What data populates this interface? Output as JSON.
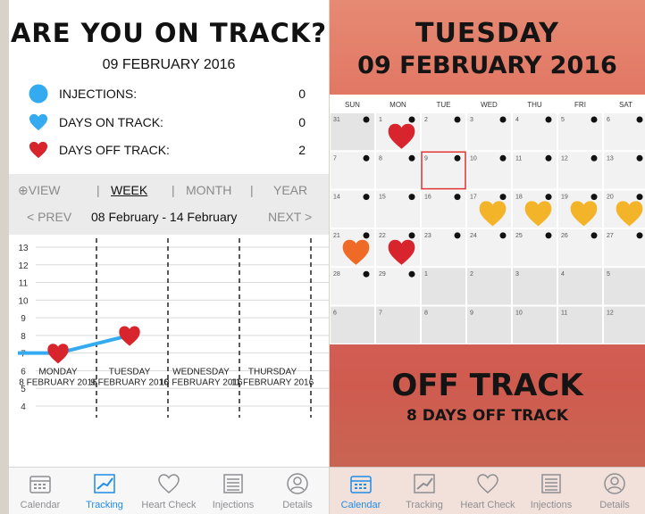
{
  "tracking": {
    "title": "ARE YOU ON TRACK?",
    "date": "09 FEBRUARY 2016",
    "stats": [
      {
        "label": "INJECTIONS:",
        "value": "0",
        "color": "#34aaf0",
        "icon": "circle-icon"
      },
      {
        "label": "DAYS ON TRACK:",
        "value": "0",
        "color": "#34aaf0",
        "icon": "heart-icon"
      },
      {
        "label": "DAYS OFF TRACK:",
        "value": "2",
        "color": "#d8242c",
        "icon": "heart-icon"
      }
    ],
    "view_label": "VIEW",
    "segments": [
      "WEEK",
      "MONTH",
      "YEAR"
    ],
    "active_segment": "WEEK",
    "prev_label": "< PREV",
    "next_label": "NEXT >",
    "range": "08 February - 14 February"
  },
  "chart_data": {
    "type": "line",
    "y_ticks": [
      4,
      5,
      6,
      7,
      8,
      9,
      10,
      11,
      12,
      13
    ],
    "ylim": [
      4,
      13.5
    ],
    "categories": [
      {
        "day": "MONDAY",
        "date": "8 FEBRUARY 2016"
      },
      {
        "day": "TUESDAY",
        "date": "9 FEBRUARY 2016"
      },
      {
        "day": "WEDNESDAY",
        "date": "10 FEBRUARY 2016"
      },
      {
        "day": "THURSDAY",
        "date": "11 FEBRUARY 2016"
      }
    ],
    "series": [
      {
        "values": [
          7,
          8
        ],
        "color": "#34aaf0",
        "marker": "heart",
        "marker_color": "#d8242c"
      }
    ]
  },
  "calendar": {
    "weekday": "TUESDAY",
    "date": "09 FEBRUARY 2016",
    "headers": [
      "SUN",
      "MON",
      "TUE",
      "WED",
      "THU",
      "FRI",
      "SAT"
    ],
    "weeks": [
      [
        "31",
        "1",
        "2",
        "3",
        "4",
        "5",
        "6"
      ],
      [
        "7",
        "8",
        "9",
        "10",
        "11",
        "12",
        "13"
      ],
      [
        "14",
        "15",
        "16",
        "17",
        "18",
        "19",
        "20"
      ],
      [
        "21",
        "22",
        "23",
        "24",
        "25",
        "26",
        "27"
      ],
      [
        "28",
        "29",
        "1",
        "2",
        "3",
        "4",
        "5"
      ],
      [
        "6",
        "7",
        "8",
        "9",
        "10",
        "11",
        "12"
      ]
    ],
    "status": "OFF TRACK",
    "summary": "8 DAYS OFF TRACK"
  },
  "tabs_left": [
    "Calendar",
    "Tracking",
    "Heart Check",
    "Injections",
    "Details"
  ],
  "tabs_right": [
    "Calendar",
    "Tracking",
    "Heart Check",
    "Injections",
    "Details"
  ]
}
